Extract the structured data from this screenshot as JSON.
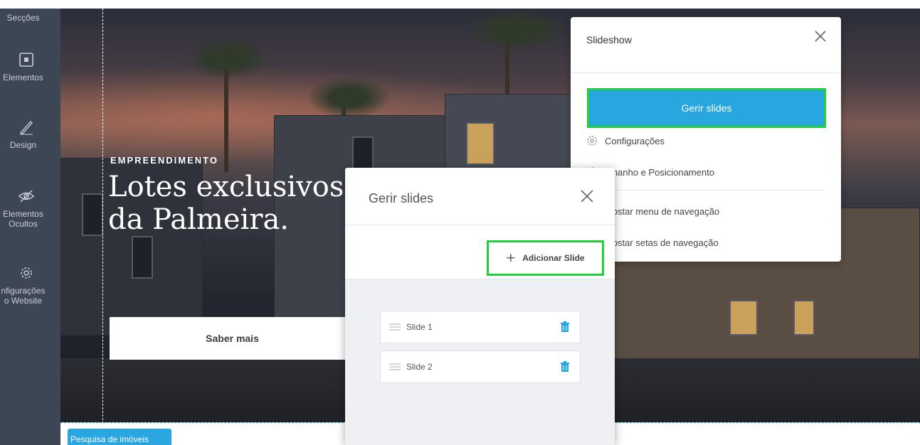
{
  "sidebar": {
    "items": [
      {
        "label": "Secções",
        "icon": "sections-icon"
      },
      {
        "label": "Elementos",
        "icon": "elements-icon"
      },
      {
        "label": "Design",
        "icon": "pen-icon"
      },
      {
        "label": "Elementos\nOcultos",
        "icon": "hidden-eye-icon"
      },
      {
        "label": "nfigurações\no Website",
        "icon": "gear-icon"
      }
    ]
  },
  "hero": {
    "eyebrow": "EMPREENDIMENTO",
    "headline": "Lotes exclusivos\nda Palmeira.",
    "cta_label": "Saber mais",
    "bottom_tab": "Pesquisa de imóveis"
  },
  "slideshow_panel": {
    "title": "Slideshow",
    "primary_button": "Gerir slides",
    "menu": [
      {
        "label": "Configurações",
        "icon": "gear-icon"
      },
      {
        "label": "amanho e Posicionamento",
        "icon": "gear-icon"
      },
      {
        "label": "Mostar menu de navegação",
        "icon": ""
      },
      {
        "label": "Mostar setas de navegação",
        "icon": ""
      }
    ]
  },
  "manage_modal": {
    "title": "Gerir slides",
    "add_button": "Adicionar Slide",
    "slides": [
      {
        "label": "Slide 1"
      },
      {
        "label": "Slide 2"
      }
    ]
  },
  "colors": {
    "sidebar_bg": "#3d4655",
    "accent_blue": "#28a6e0",
    "highlight_green": "#22d13a"
  }
}
